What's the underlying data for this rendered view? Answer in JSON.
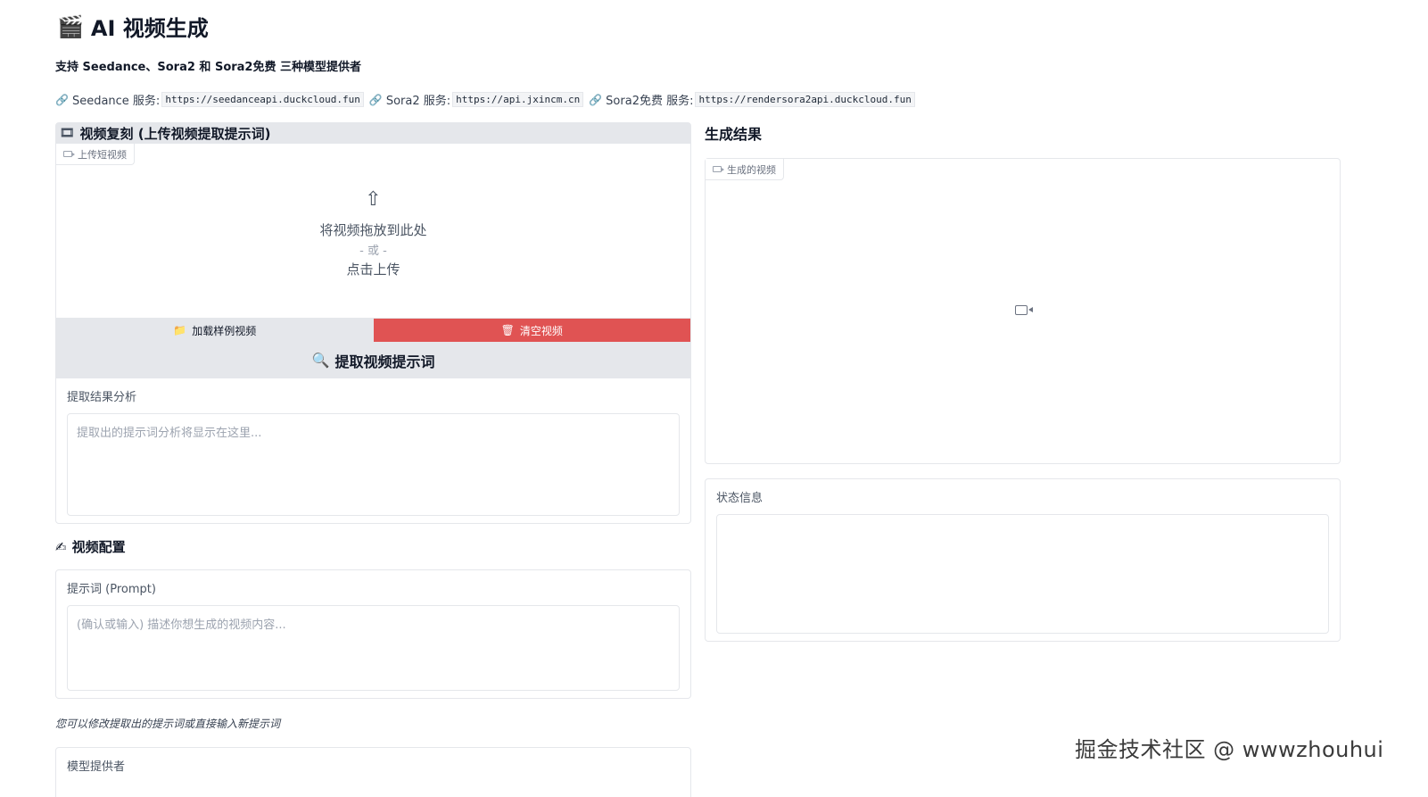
{
  "header": {
    "icon": "clapperboard-icon",
    "title": "AI 视频生成",
    "subtitle": "支持 Seedance、Sora2 和 Sora2免费 三种模型提供者"
  },
  "services": [
    {
      "label": "Seedance 服务:",
      "url": "https://seedanceapi.duckcloud.fun"
    },
    {
      "label": "Sora2 服务:",
      "url": "https://api.jxincm.cn"
    },
    {
      "label": "Sora2免费 服务:",
      "url": "https://rendersora2api.duckcloud.fun"
    }
  ],
  "replicate": {
    "title": "视频复刻 (上传视频提取提示词)",
    "upload_tag": "上传短视频",
    "drop_line1": "将视频拖放到此处",
    "drop_line2": "- 或 -",
    "drop_line3": "点击上传",
    "load_button": "加载样例视频",
    "clear_button": "清空视频",
    "extract_button": "提取视频提示词",
    "analysis_label": "提取结果分析",
    "analysis_placeholder": "提取出的提示词分析将显示在这里..."
  },
  "config": {
    "title": "视频配置",
    "prompt_label": "提示词 (Prompt)",
    "prompt_placeholder": "(确认或输入) 描述你想生成的视频内容...",
    "note": "您可以修改提取出的提示词或直接输入新提示词",
    "provider_label": "模型提供者"
  },
  "result": {
    "title": "生成结果",
    "video_tag": "生成的视频",
    "status_label": "状态信息"
  },
  "watermark": "掘金技术社区 @ wwwzhouhui",
  "colors": {
    "clear_button": "#e05353",
    "section_bg": "#e5e7eb"
  }
}
